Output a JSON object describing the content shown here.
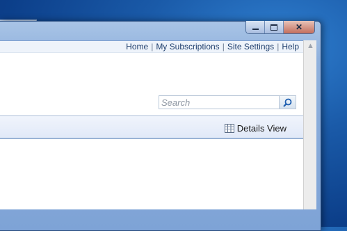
{
  "window": {
    "caption_buttons": [
      "minimize",
      "maximize",
      "close"
    ],
    "toolbar_icons": [
      "home-icon",
      "favorites-star-icon",
      "settings-gear-icon"
    ]
  },
  "top_links": {
    "home": "Home",
    "my_subscriptions": "My Subscriptions",
    "site_settings": "Site Settings",
    "help": "Help",
    "separator": "|"
  },
  "search": {
    "placeholder": "Search"
  },
  "view": {
    "details_view_label": "Details View"
  },
  "colors": {
    "desktop": "#1a5aa8",
    "link": "#21406e",
    "view_bar": "#e6edf9"
  }
}
